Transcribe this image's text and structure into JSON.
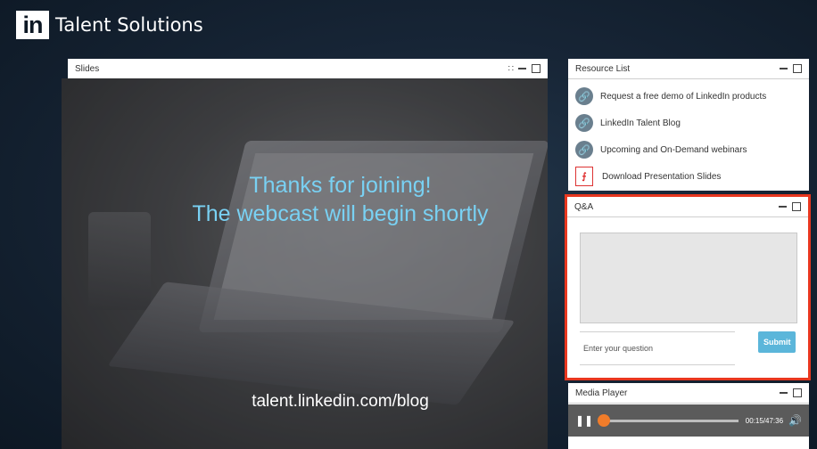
{
  "header": {
    "logo_text": "in",
    "brand": "Talent Solutions"
  },
  "slides_panel": {
    "title": "Slides",
    "slide": {
      "line1": "Thanks for joining!",
      "line2": "The webcast will begin shortly",
      "url": "talent.linkedin.com/blog"
    }
  },
  "resources_panel": {
    "title": "Resource List",
    "items": [
      {
        "label": "Request a free demo of LinkedIn products",
        "icon": "link-icon"
      },
      {
        "label": "LinkedIn Talent Blog",
        "icon": "link-icon"
      },
      {
        "label": "Upcoming and On-Demand webinars",
        "icon": "link-icon"
      },
      {
        "label": "Download Presentation Slides",
        "icon": "pdf-icon"
      }
    ]
  },
  "qa_panel": {
    "title": "Q&A",
    "input_placeholder": "Enter your question",
    "submit_label": "Submit"
  },
  "media_player": {
    "title": "Media Player",
    "time": "00:15/47:36",
    "progress": 0.01
  },
  "colors": {
    "accent": "#5bb6da",
    "highlight": "#e8371f",
    "scrub": "#f07c2a",
    "slide_text": "#79d1f3"
  }
}
